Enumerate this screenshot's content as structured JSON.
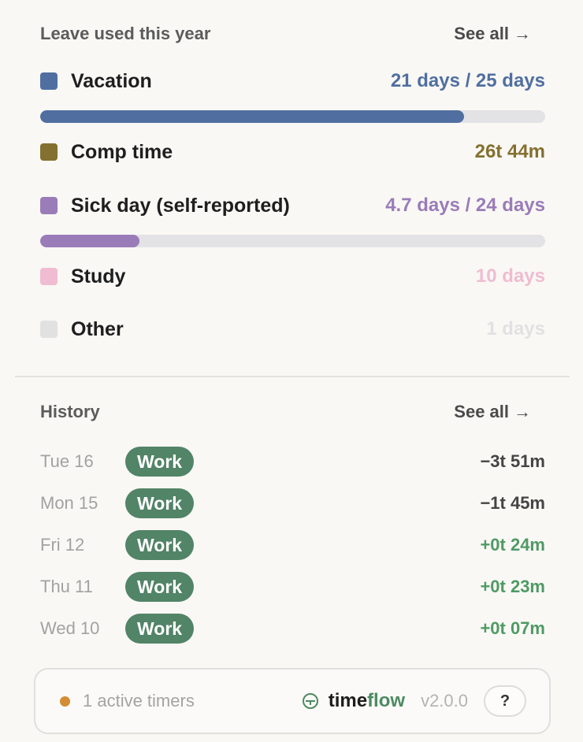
{
  "leave": {
    "title": "Leave used this year",
    "see_all": "See all",
    "items": [
      {
        "label": "Vacation",
        "value": "21 days / 25 days",
        "color": "#506fa0",
        "progress": 0.84
      },
      {
        "label": "Comp time",
        "value": "26t 44m",
        "color": "#84702f"
      },
      {
        "label": "Sick day (self-reported)",
        "value": "4.7 days / 24 days",
        "color": "#9a7cb8",
        "progress": 0.196
      },
      {
        "label": "Study",
        "value": "10 days",
        "color": "#f0bcd1"
      },
      {
        "label": "Other",
        "value": "1 days",
        "color": "#e1e1e1"
      }
    ]
  },
  "history": {
    "title": "History",
    "see_all": "See all",
    "rows": [
      {
        "date": "Tue 16",
        "tag": "Work",
        "delta": "−3t 51m",
        "delta_color": "#444444"
      },
      {
        "date": "Mon 15",
        "tag": "Work",
        "delta": "−1t 45m",
        "delta_color": "#444444"
      },
      {
        "date": "Fri 12",
        "tag": "Work",
        "delta": "+0t 24m",
        "delta_color": "#4f9a64"
      },
      {
        "date": "Thu 11",
        "tag": "Work",
        "delta": "+0t 23m",
        "delta_color": "#4f9a64"
      },
      {
        "date": "Wed 10",
        "tag": "Work",
        "delta": "+0t 07m",
        "delta_color": "#4f9a64"
      }
    ]
  },
  "footer": {
    "active_timers": "1 active timers",
    "brand_a": "time",
    "brand_b": "flow",
    "version": "v2.0.0",
    "help": "?"
  }
}
